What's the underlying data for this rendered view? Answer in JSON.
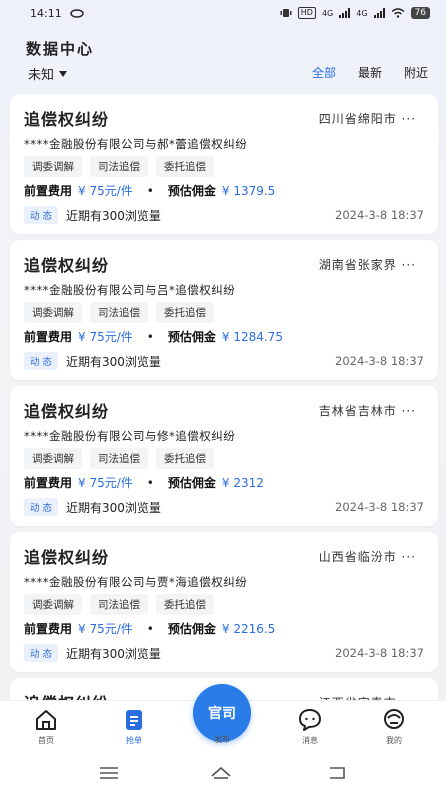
{
  "status_bar": {
    "time": "14:11",
    "hd": "HD",
    "net1": "4G",
    "net2": "4G",
    "battery": "76"
  },
  "header": {
    "title": "数据中心"
  },
  "filter": {
    "selected": "未知",
    "tabs": [
      "全部",
      "最新",
      "附近"
    ],
    "active_tab": 0
  },
  "cards": [
    {
      "title": "追偿权纠纷",
      "region": "四川省绵阳市 ···",
      "desc": "****金融股份有限公司与郝*蕾追偿权纠纷",
      "tags": [
        "调委调解",
        "司法追偿",
        "委托追偿"
      ],
      "fee_label": "前置费用",
      "fee_value": "¥ 75元/件",
      "commission_label": "预估佣金",
      "commission_value": "¥ 1379.5",
      "badge": "动 态",
      "views": "近期有300浏览量",
      "time": "2024-3-8 18:37"
    },
    {
      "title": "追偿权纠纷",
      "region": "湖南省张家界 ···",
      "desc": "****金融股份有限公司与吕*追偿权纠纷",
      "tags": [
        "调委调解",
        "司法追偿",
        "委托追偿"
      ],
      "fee_label": "前置费用",
      "fee_value": "¥ 75元/件",
      "commission_label": "预估佣金",
      "commission_value": "¥ 1284.75",
      "badge": "动 态",
      "views": "近期有300浏览量",
      "time": "2024-3-8 18:37"
    },
    {
      "title": "追偿权纠纷",
      "region": "吉林省吉林市 ···",
      "desc": "****金融股份有限公司与修*追偿权纠纷",
      "tags": [
        "调委调解",
        "司法追偿",
        "委托追偿"
      ],
      "fee_label": "前置费用",
      "fee_value": "¥ 75元/件",
      "commission_label": "预估佣金",
      "commission_value": "¥ 2312",
      "badge": "动 态",
      "views": "近期有300浏览量",
      "time": "2024-3-8 18:37"
    },
    {
      "title": "追偿权纠纷",
      "region": "山西省临汾市 ···",
      "desc": "****金融股份有限公司与贾*海追偿权纠纷",
      "tags": [
        "调委调解",
        "司法追偿",
        "委托追偿"
      ],
      "fee_label": "前置费用",
      "fee_value": "¥ 75元/件",
      "commission_label": "预估佣金",
      "commission_value": "¥ 2216.5",
      "badge": "动 态",
      "views": "近期有300浏览量",
      "time": "2024-3-8 18:37"
    }
  ],
  "partial_card": {
    "title": "追偿权纠纷",
    "region": "江西省宜春市 ···"
  },
  "bottom_nav": {
    "items": [
      {
        "label": "首页",
        "icon": "home-icon"
      },
      {
        "label": "抢单",
        "icon": "clipboard-icon"
      },
      {
        "label": "发布",
        "icon": "publish-icon"
      },
      {
        "label": "消息",
        "icon": "chat-icon"
      },
      {
        "label": "我的",
        "icon": "profile-icon"
      }
    ],
    "fab_label": "官司"
  },
  "colors": {
    "accent": "#2a6de0",
    "fab": "#2a7ce8"
  }
}
